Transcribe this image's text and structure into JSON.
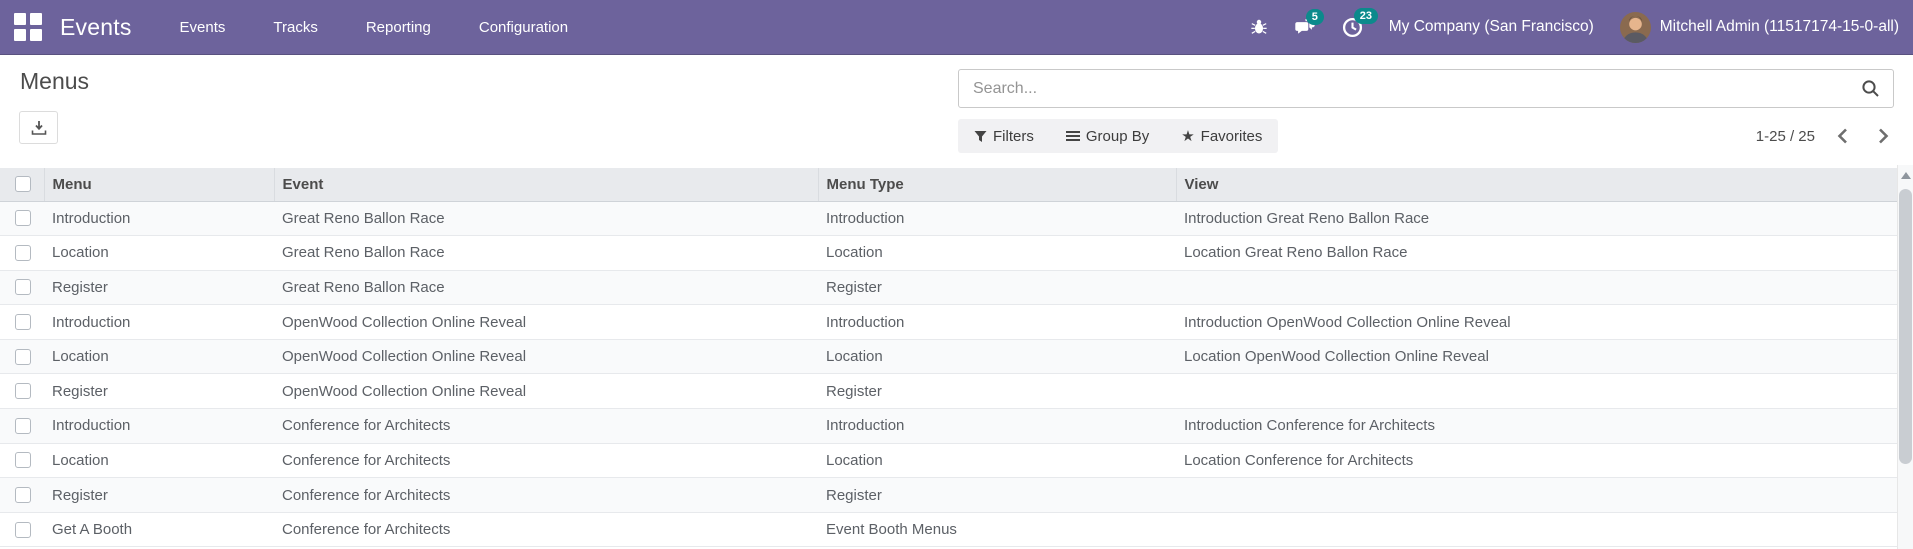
{
  "colors": {
    "navbar_bg": "#6d639c",
    "badge_bg": "#0c8a8c",
    "table_header_bg": "#e8eaed"
  },
  "navbar": {
    "app_title": "Events",
    "menu_items": [
      "Events",
      "Tracks",
      "Reporting",
      "Configuration"
    ],
    "messages_badge": "5",
    "activities_badge": "23",
    "company": "My Company (San Francisco)",
    "user": "Mitchell Admin (11517174-15-0-all)"
  },
  "control_panel": {
    "title": "Menus",
    "search_placeholder": "Search...",
    "filters_label": "Filters",
    "group_by_label": "Group By",
    "favorites_label": "Favorites",
    "pager": "1-25 / 25"
  },
  "table": {
    "columns": [
      "Menu",
      "Event",
      "Menu Type",
      "View"
    ],
    "rows": [
      {
        "menu": "Introduction",
        "event": "Great Reno Ballon Race",
        "menu_type": "Introduction",
        "view": "Introduction Great Reno Ballon Race"
      },
      {
        "menu": "Location",
        "event": "Great Reno Ballon Race",
        "menu_type": "Location",
        "view": "Location Great Reno Ballon Race"
      },
      {
        "menu": "Register",
        "event": "Great Reno Ballon Race",
        "menu_type": "Register",
        "view": ""
      },
      {
        "menu": "Introduction",
        "event": "OpenWood Collection Online Reveal",
        "menu_type": "Introduction",
        "view": "Introduction OpenWood Collection Online Reveal"
      },
      {
        "menu": "Location",
        "event": "OpenWood Collection Online Reveal",
        "menu_type": "Location",
        "view": "Location OpenWood Collection Online Reveal"
      },
      {
        "menu": "Register",
        "event": "OpenWood Collection Online Reveal",
        "menu_type": "Register",
        "view": ""
      },
      {
        "menu": "Introduction",
        "event": "Conference for Architects",
        "menu_type": "Introduction",
        "view": "Introduction Conference for Architects"
      },
      {
        "menu": "Location",
        "event": "Conference for Architects",
        "menu_type": "Location",
        "view": "Location Conference for Architects"
      },
      {
        "menu": "Register",
        "event": "Conference for Architects",
        "menu_type": "Register",
        "view": ""
      },
      {
        "menu": "Get A Booth",
        "event": "Conference for Architects",
        "menu_type": "Event Booth Menus",
        "view": ""
      }
    ]
  }
}
